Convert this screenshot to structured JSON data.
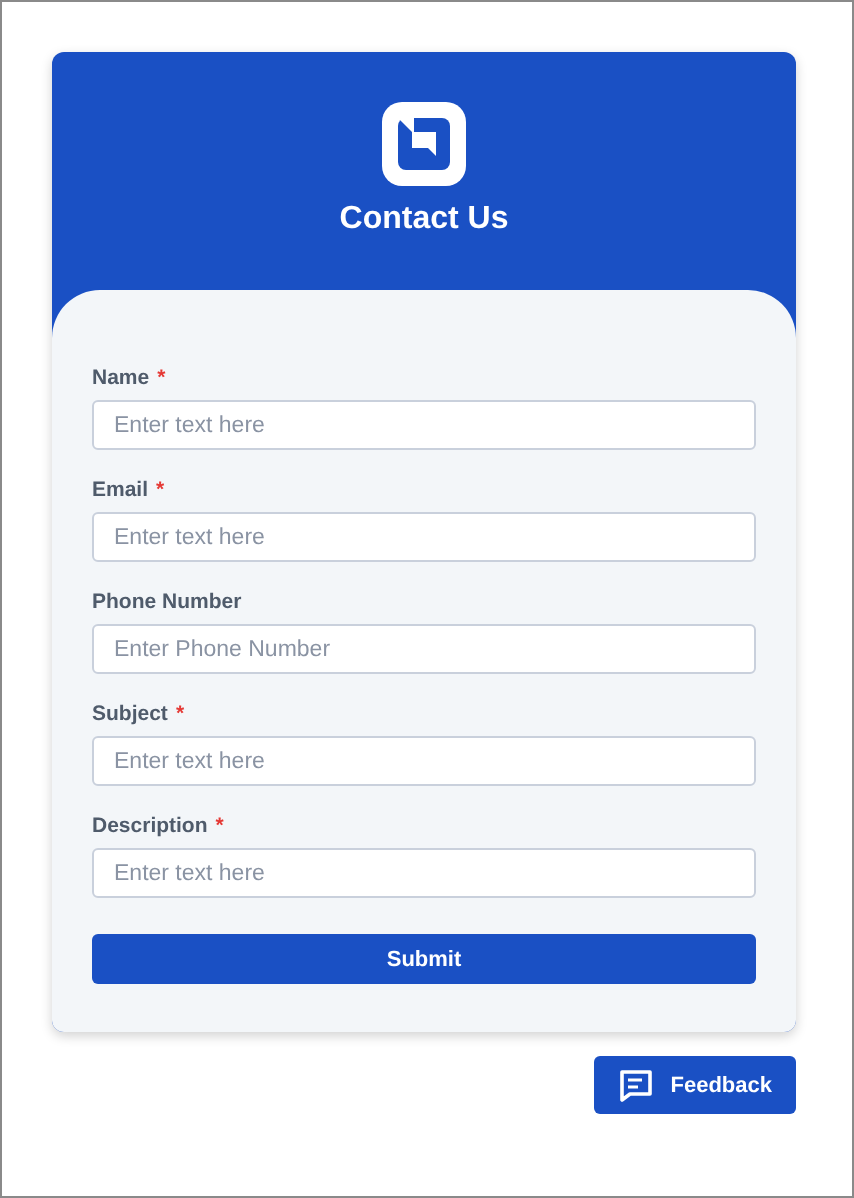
{
  "header": {
    "title": "Contact Us"
  },
  "fields": [
    {
      "label": "Name",
      "required_mark": "*",
      "placeholder": "Enter text here"
    },
    {
      "label": "Email",
      "required_mark": "*",
      "placeholder": "Enter text here"
    },
    {
      "label": "Phone Number",
      "placeholder": "Enter Phone Number"
    },
    {
      "label": "Subject",
      "required_mark": "*",
      "placeholder": "Enter text here"
    },
    {
      "label": "Description",
      "required_mark": "*",
      "placeholder": "Enter text here"
    }
  ],
  "submit_button": "Submit",
  "feedback_button": "Feedback"
}
